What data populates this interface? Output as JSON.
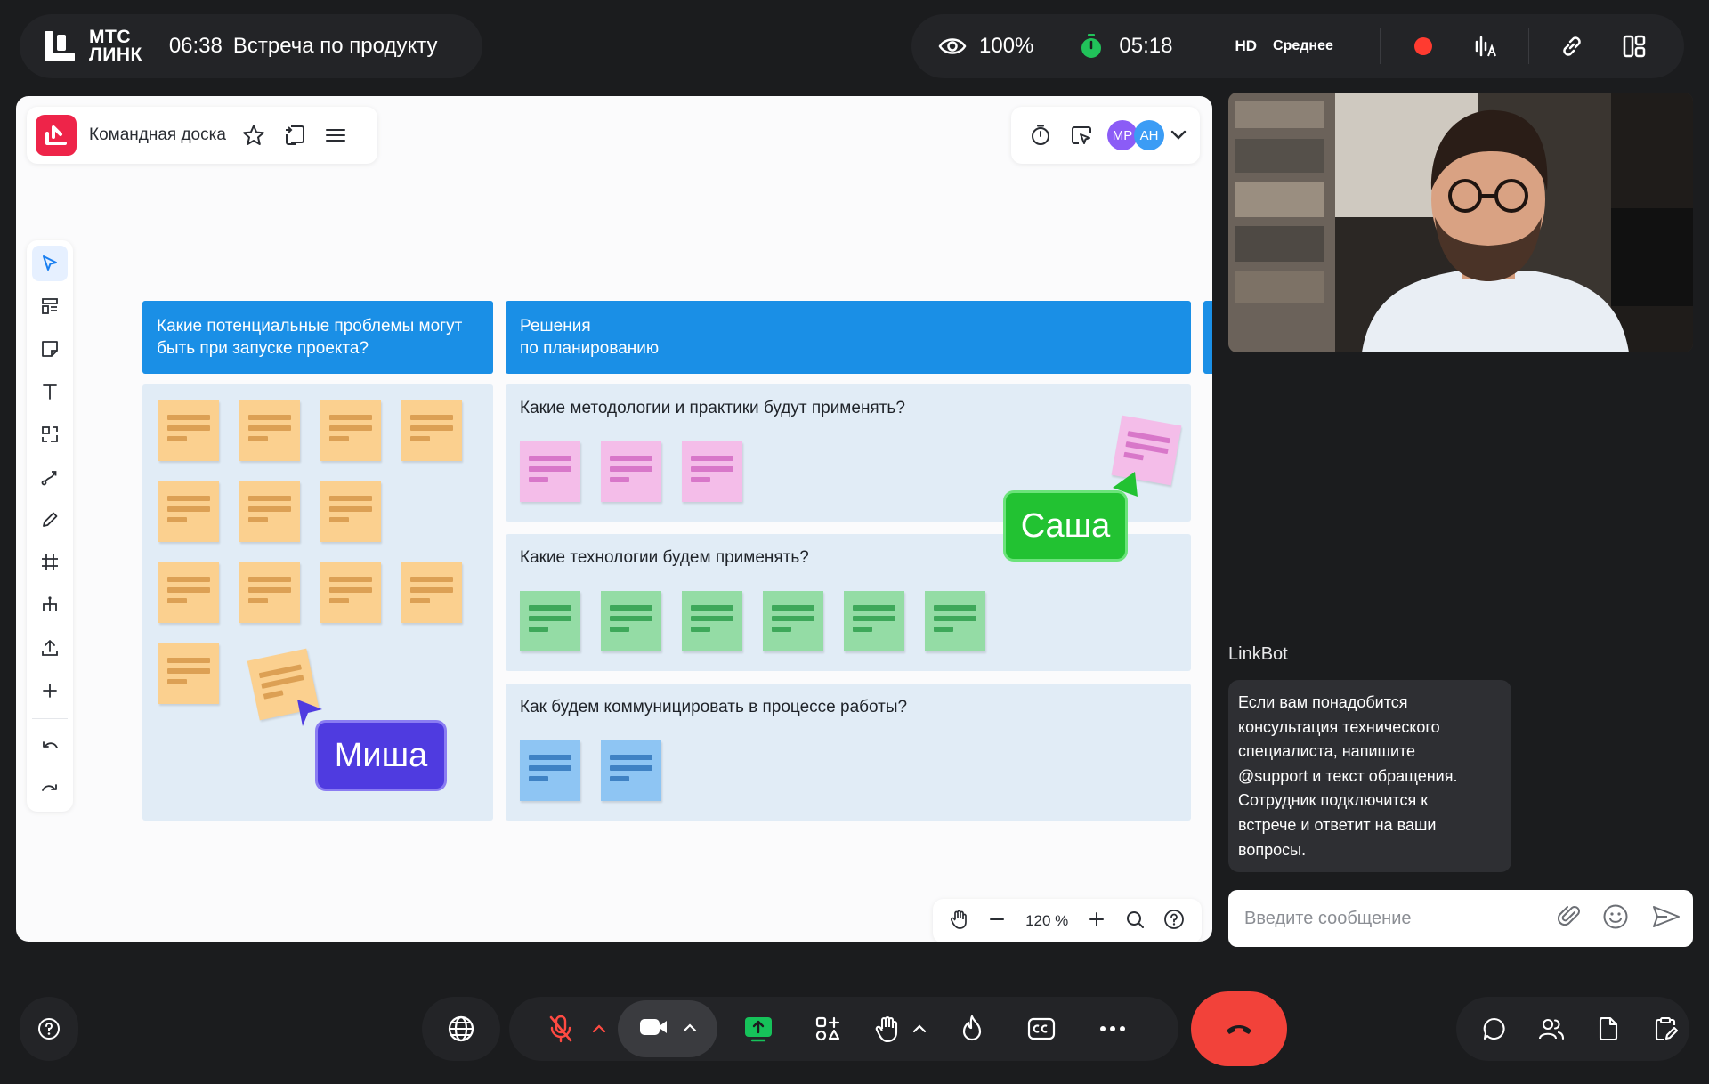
{
  "top": {
    "logo_text_1": "МТС",
    "logo_text_2": "ЛИНК",
    "meeting_time": "06:38",
    "meeting_title": "Встреча по продукту",
    "visibility": "100%",
    "timer": "05:18",
    "quality_badge": "HD",
    "quality_level": "Среднее",
    "record_color": "#ff3b30"
  },
  "board": {
    "name": "Командная доска",
    "avatars": [
      {
        "initials": "МР",
        "color": "#8b5cf6"
      },
      {
        "initials": "АН",
        "color": "#3b9cf5"
      }
    ],
    "columns": [
      {
        "header": "Какие потенциальные проблемы могут быть при запуске проекта?"
      },
      {
        "header_line1": "Решения",
        "header_line2": "по планированию"
      }
    ],
    "questions": [
      "Какие методологии и практики будут применять?",
      "Какие технологии будем применять?",
      "Как будем коммуницировать в процессе работы?"
    ],
    "cursors": [
      {
        "name": "Саша",
        "color": "#22c232"
      },
      {
        "name": "Миша",
        "color": "#4f3be0"
      }
    ],
    "zoom": "120 %"
  },
  "chat": {
    "author": "LinkBot",
    "message_lines": [
      "Если вам понадобится",
      "консультация технического",
      "специалиста, напишите",
      "@support и текст обращения.",
      "Сотрудник подключится к",
      "встрече и ответит на ваши",
      "вопросы."
    ],
    "placeholder": "Введите сообщение"
  },
  "colors": {
    "accent_blue": "#1a8fe6",
    "hangup": "#f2423a",
    "share_green": "#16c25a"
  }
}
